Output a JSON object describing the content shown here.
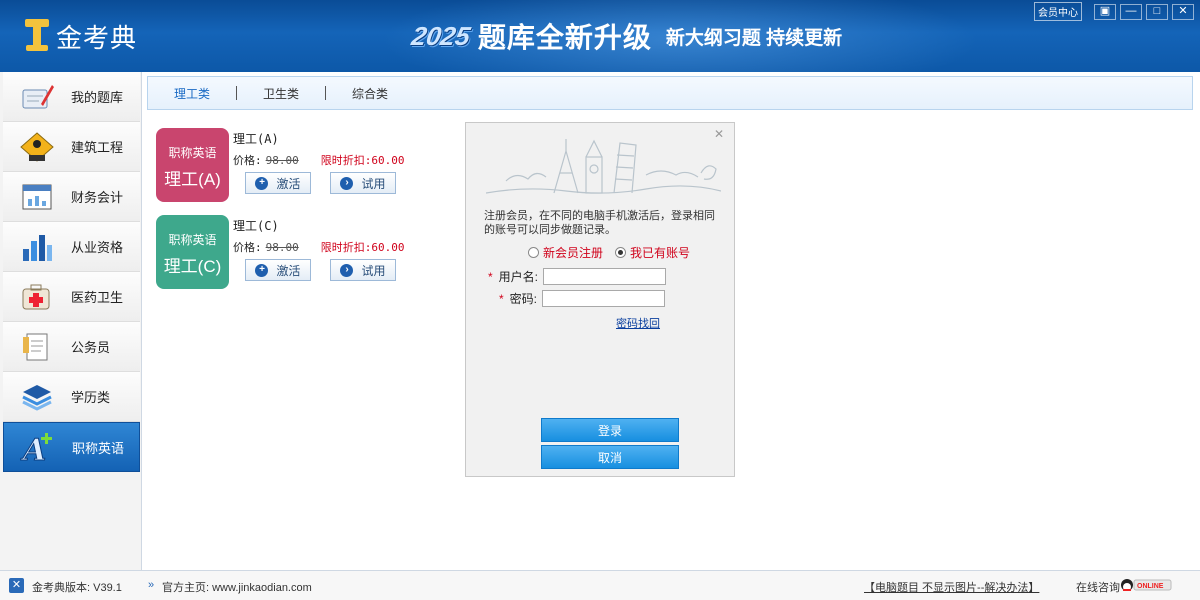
{
  "app": {
    "name": "金考典",
    "slogan_year": "2025",
    "slogan_main": "题库全新升级",
    "slogan_sub": "新大纲习题 持续更新",
    "member_center": "会员中心"
  },
  "sidebar": {
    "items": [
      {
        "label": "我的题库",
        "icon": "pen-notebook-icon"
      },
      {
        "label": "建筑工程",
        "icon": "construction-sign-icon"
      },
      {
        "label": "财务会计",
        "icon": "calendar-chart-icon"
      },
      {
        "label": "从业资格",
        "icon": "bar-chart-icon"
      },
      {
        "label": "医药卫生",
        "icon": "medical-kit-icon"
      },
      {
        "label": "公务员",
        "icon": "document-icon"
      },
      {
        "label": "学历类",
        "icon": "layers-icon"
      },
      {
        "label": "职称英语",
        "icon": "letter-a-icon",
        "active": true
      }
    ]
  },
  "tabs": [
    {
      "label": "理工类",
      "active": true
    },
    {
      "label": "卫生类"
    },
    {
      "label": "综合类"
    }
  ],
  "products": [
    {
      "badge_line1": "职称英语",
      "badge_line2": "理工(A)",
      "badge_color": "#c9456e",
      "title": "理工(A)",
      "price_label": "价格:",
      "price_old": "98.00",
      "discount_label": "限时折扣:",
      "discount_price": "60.00",
      "activate_label": "激活",
      "trial_label": "试用"
    },
    {
      "badge_line1": "职称英语",
      "badge_line2": "理工(C)",
      "badge_color": "#3ea88c",
      "title": "理工(C)",
      "price_label": "价格:",
      "price_old": "98.00",
      "discount_label": "限时折扣:",
      "discount_price": "60.00",
      "activate_label": "激活",
      "trial_label": "试用"
    }
  ],
  "dialog": {
    "hint": "注册会员，在不同的电脑手机激活后，登录相同的账号可以同步做题记录。",
    "radio_new": "新会员注册",
    "radio_existing": "我已有账号",
    "selected": "existing",
    "username_label": "用户名:",
    "password_label": "密码:",
    "username_value": "",
    "password_value": "",
    "forgot_link": "密码找回",
    "login_button": "登录",
    "cancel_button": "取消"
  },
  "statusbar": {
    "version": "金考典版本: V39.1",
    "homepage": "官方主页: www.jinkaodian.com",
    "notice": "【电脑题目 不显示图片--解决办法】",
    "online_consult": "在线咨询",
    "online_badge": "ONLINE"
  }
}
